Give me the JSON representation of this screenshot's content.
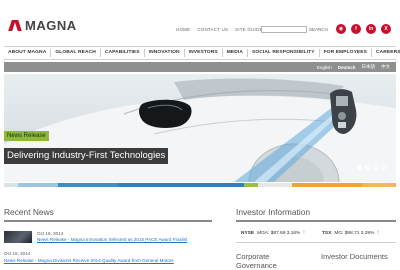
{
  "brand": {
    "logo_text": "MAGNA",
    "accent": "#c8102e"
  },
  "utility": {
    "home": "HOME",
    "contact": "CONTACT US",
    "sitemap": "SITE GUIDE",
    "search_label": "SEARCH",
    "search_placeholder": ""
  },
  "social": [
    {
      "name": "rss-icon",
      "glyph": "◉"
    },
    {
      "name": "facebook-icon",
      "glyph": "f"
    },
    {
      "name": "linkedin-icon",
      "glyph": "in"
    },
    {
      "name": "xing-icon",
      "glyph": "X"
    }
  ],
  "nav": [
    "ABOUT MAGNA",
    "GLOBAL REACH",
    "CAPABILITIES",
    "INNOVATION",
    "INVESTORS",
    "MEDIA",
    "SOCIAL RESPONSIBILITY",
    "FOR EMPLOYEES",
    "CAREERS"
  ],
  "languages": {
    "en": "English",
    "de": "Deutsch",
    "ja": "日本語",
    "zh": "中文"
  },
  "hero": {
    "badge": "News Release",
    "headline": "Delivering Industry-First Technologies",
    "slides": 4,
    "active_slide": 1
  },
  "strip_colors": [
    "#d7e3ea",
    "#9cc7de",
    "#3d8ecb",
    "#2f7fc1",
    "#9ac23c",
    "#e7e7e7",
    "#f2a03a",
    "#f7b45a"
  ],
  "news": {
    "title": "Recent News",
    "items": [
      {
        "date": "Oct 16, 2014",
        "link": "News Release - Magna Innovation Selected as 2015 PACE Award Finalist"
      },
      {
        "date": "Oct 15, 2014",
        "link": "News Release - Magna Divisions Receive 2014 Quality Award from General Motors"
      }
    ]
  },
  "investor": {
    "title": "Investor Information",
    "nyse": {
      "exchange": "NYSE",
      "symbol": "MGA:",
      "price": "$87.69",
      "change": "3.16%"
    },
    "tsx": {
      "exchange": "TSX",
      "symbol": "MG:",
      "price": "$98.71",
      "change": "3.29%"
    },
    "corporate_governance": "Corporate Governance",
    "investor_documents": "Investor Documents"
  }
}
